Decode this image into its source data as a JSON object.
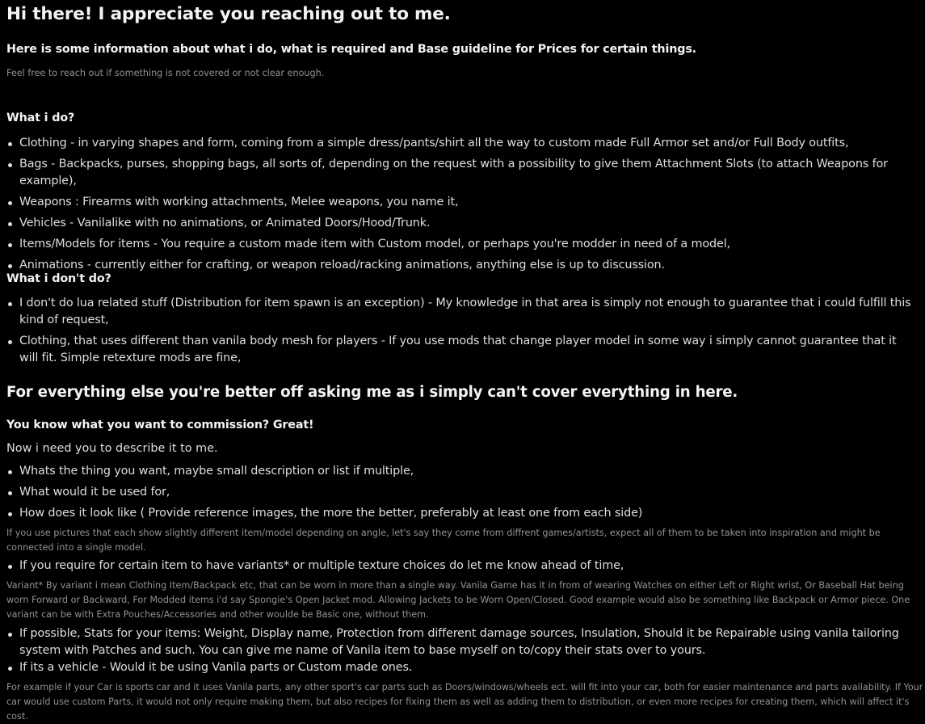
{
  "header": {
    "title": "Hi there! I appreciate you reaching out to me.",
    "intro": "Here is some information about what i do, what is required and Base guideline for Prices for certain things.",
    "note": "Feel free to reach out if something is not covered or not clear enough."
  },
  "do_section": {
    "heading": "What i do?",
    "items": [
      "Clothing - in varying shapes and form, coming from a simple dress/pants/shirt all the way to custom made Full Armor set and/or Full Body outfits,",
      "Bags - Backpacks, purses, shopping bags, all sorts of, depending on the request with a possibility to give them Attachment Slots (to attach Weapons for example),",
      "Weapons : Firearms with working attachments, Melee weapons, you name it,",
      "Vehicles - Vanilalike with no animations, or Animated Doors/Hood/Trunk.",
      "Items/Models for items - You require a custom made item with Custom model, or perhaps you're modder in need of a model,",
      "Animations - currently either for crafting, or weapon reload/racking animations, anything else is up to discussion."
    ]
  },
  "dont_section": {
    "heading": "What i don't do?",
    "items": [
      "I don't do lua related stuff (Distribution for item spawn is an exception) - My knowledge in that area is simply not enough to guarantee that i could fulfill this kind of request,",
      "Clothing, that uses different than vanila body mesh for players - If you use mods that change player model in some way i simply cannot guarantee that it will fit. Simple retexture mods are fine,"
    ]
  },
  "everything_else": "For everything else you're better off asking me as i simply can't cover everything in here.",
  "commission": {
    "heading": "You know what you want to commission? Great!",
    "lead": "Now i need you to describe it to me.",
    "items": [
      "Whats the thing you want, maybe small description or list if multiple,",
      "What would it be used for,",
      "How does it look like ( Provide reference images, the more the better, preferably at least one from each side)"
    ],
    "pictures_note": "If you use pictures that each show slightly different item/model depending on angle, let's say they come from diffrent games/artists, expect all of them to be taken into inspiration and might be connected into a single model.",
    "variants_item": "If you require for certain item to have variants* or multiple texture choices do let me know ahead of time,",
    "variant_note": "Variant*  By variant i mean Clothing Item/Backpack etc, that can be worn in more than a single way. Vanila Game has it in from of wearing Watches on either Left or Right wrist, Or Baseball Hat being worn Forward or Backward, For Modded items i'd say Spongie's Open Jacket mod. Allowing Jackets to be Worn Open/Closed. Good example would also be something like Backpack or Armor piece. One variant can be with Extra Pouches/Accessories and other woulde be Basic one, without them.",
    "stats_item": "If possible, Stats for your items: Weight, Display name, Protection from different damage sources, Insulation, Should it be Repairable using vanila tailoring system with Patches and such. You can give me name of Vanila item to base myself on to/copy their stats over to yours.",
    "vehicle_item": "If its a vehicle - Would it be using Vanila parts or Custom made ones.",
    "vehicle_note": "For example if your Car is sports car and it uses Vanila parts, any other sport's car parts such as Doors/windows/wheels ect. will fit into your car, both for easier maintenance and parts availability. If Your car would use custom Parts, it would not only require making them, but also recipes for fixing them as well as adding them to distribution, or even more recipes for creating them, which will affect it's cost."
  }
}
